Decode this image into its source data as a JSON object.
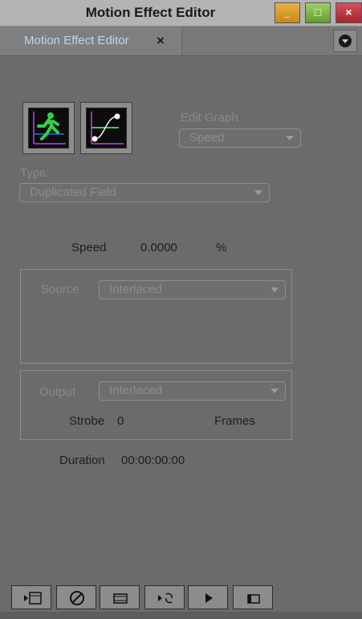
{
  "window": {
    "title": "Motion Effect Editor",
    "min_label": "_",
    "max_label": "□",
    "close_label": "×"
  },
  "tab": {
    "label": "Motion Effect Editor",
    "close_label": "×"
  },
  "edit_graph": {
    "label": "Edit Graph",
    "value": "Speed"
  },
  "type": {
    "label": "Type:",
    "value": "Duplicated Field"
  },
  "speed": {
    "label": "Speed",
    "value": "0.0000",
    "unit": "%"
  },
  "source": {
    "label": "Source",
    "value": "Interlaced"
  },
  "output": {
    "label": "Output",
    "value": "Interlaced"
  },
  "strobe": {
    "label": "Strobe",
    "value": "0",
    "unit": "Frames"
  },
  "duration": {
    "label": "Duration",
    "value": "00:00:00:00"
  },
  "toolbar_icons": [
    "render-icon",
    "cancel-icon",
    "filmstrip-icon",
    "swap-icon",
    "play-icon",
    "clip-icon"
  ]
}
